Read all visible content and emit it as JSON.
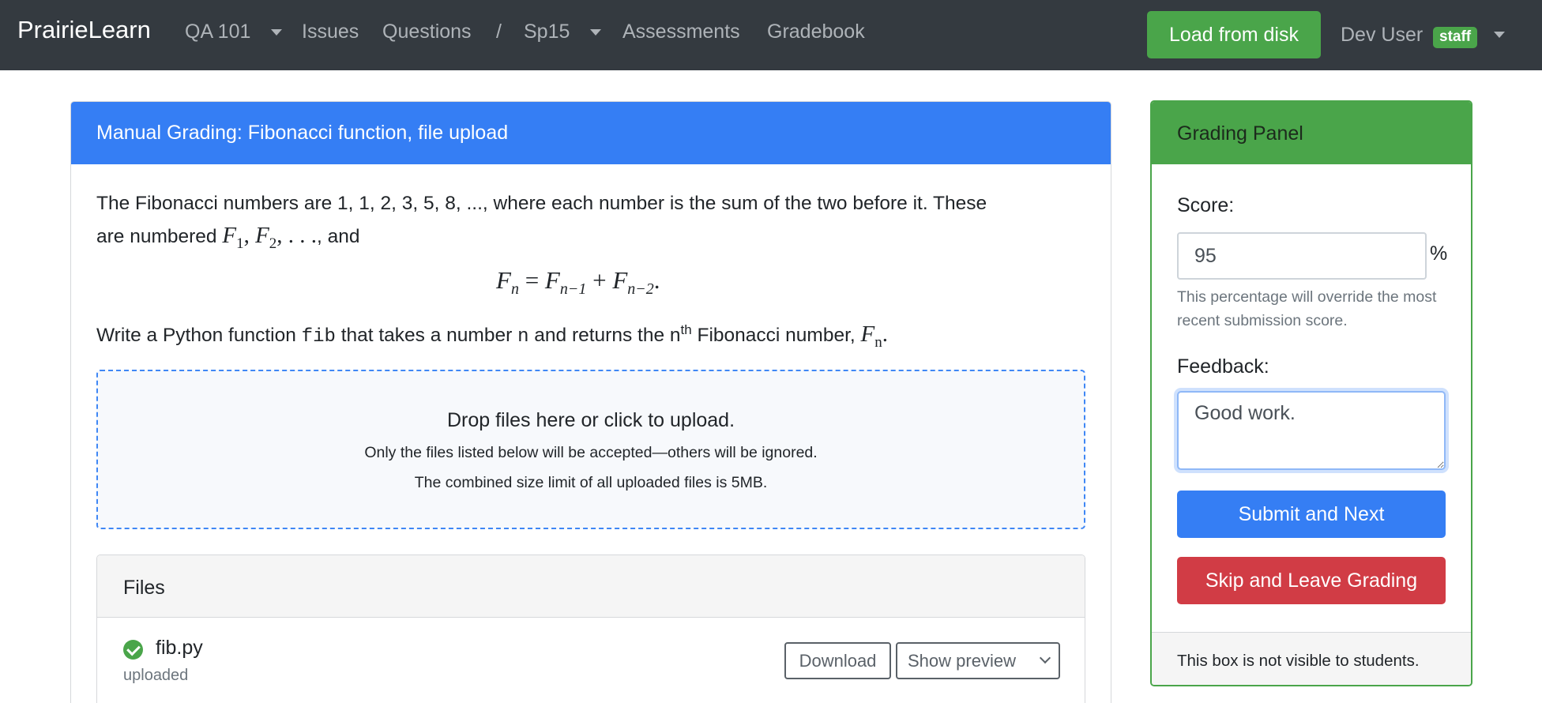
{
  "navbar": {
    "brand": "PrairieLearn",
    "course": "QA 101",
    "issues": "Issues",
    "questions": "Questions",
    "separator": "/",
    "course_instance": "Sp15",
    "assessments": "Assessments",
    "gradebook": "Gradebook",
    "load_from_disk": "Load from disk",
    "user_name": "Dev User",
    "user_badge": "staff"
  },
  "question": {
    "header": "Manual Grading: Fibonacci function, file upload",
    "para1_line1": "The Fibonacci numbers are 1, 1, 2, 3, 5, 8, ..., where each number is the sum of the two before it. These",
    "para1_line2_prefix": "are numbered",
    "para1_line2_suffix": ", and",
    "para2_prefix": "Write a Python function",
    "para2_code_fib": "fib",
    "para2_mid": "that takes a number",
    "para2_code_n": "n",
    "para2_after_n": "and returns the n",
    "para2_sup": "th",
    "para2_suffix": "Fibonacci number,"
  },
  "dropzone": {
    "title": "Drop files here or click to upload.",
    "line1": "Only the files listed below will be accepted—others will be ignored.",
    "line2": "The combined size limit of all uploaded files is 5MB."
  },
  "files": {
    "header": "Files",
    "items": [
      {
        "name": "fib.py",
        "status": "uploaded",
        "download_label": "Download",
        "preview_label": "Show preview"
      }
    ]
  },
  "grading": {
    "header": "Grading Panel",
    "score_label": "Score:",
    "score_value": "95",
    "score_unit": "%",
    "score_help": "This percentage will override the most recent submission score.",
    "feedback_label": "Feedback:",
    "feedback_value": "Good work.",
    "submit_label": "Submit and Next",
    "skip_label": "Skip and Leave Grading",
    "footer": "This box is not visible to students."
  },
  "colors": {
    "navbar": "#343a40",
    "primary": "#357ef4",
    "success": "#4aa54a",
    "danger": "#d13c45"
  }
}
